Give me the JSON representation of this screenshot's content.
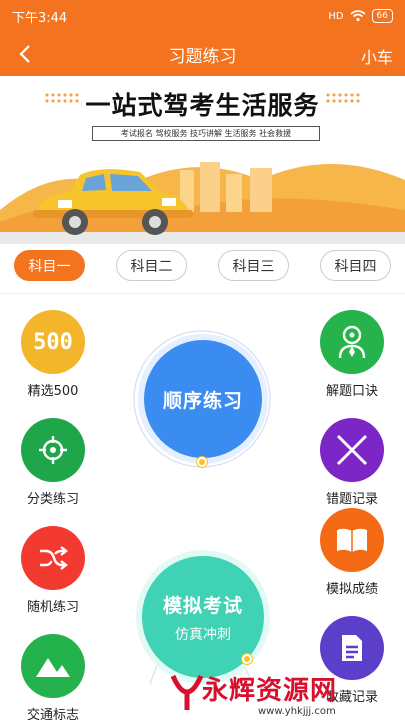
{
  "status_bar": {
    "time": "下午3:44",
    "signal": "HD",
    "battery": "66"
  },
  "header": {
    "title": "习题练习",
    "right": "小车"
  },
  "banner": {
    "headline": "一站式驾考生活服务",
    "tags": "考试报名  驾校服务  技巧讲解  生活服务  社会救援"
  },
  "tabs": [
    {
      "label": "科目一",
      "active": true
    },
    {
      "label": "科目二",
      "active": false
    },
    {
      "label": "科目三",
      "active": false
    },
    {
      "label": "科目四",
      "active": false
    }
  ],
  "left_items": [
    {
      "label": "精选500",
      "icon_text": "500",
      "icon": "500-icon",
      "color": "#f3b62a"
    },
    {
      "label": "分类练习",
      "icon": "target-icon",
      "color": "#1fa64a"
    },
    {
      "label": "随机练习",
      "icon": "shuffle-icon",
      "color": "#f23a30"
    },
    {
      "label": "交通标志",
      "icon": "mountain-icon",
      "color": "#23b24b"
    }
  ],
  "right_items": [
    {
      "label": "解题口诀",
      "icon": "person-icon",
      "color": "#26b34b"
    },
    {
      "label": "错题记录",
      "icon": "cross-icon",
      "color": "#7d26c7"
    },
    {
      "label": "模拟成绩",
      "icon": "book-icon",
      "color": "#f56a14"
    },
    {
      "label": "收藏记录",
      "icon": "document-icon",
      "color": "#5b3ec9"
    }
  ],
  "center": {
    "sequence": "顺序练习",
    "exam_title": "模拟考试",
    "exam_sub": "仿真冲刺"
  },
  "watermark": {
    "text": "永辉资源网",
    "url": "www.yhkjjj.com"
  },
  "colors": {
    "brand": "#f4731f",
    "sequence": "#3b8cf0",
    "exam": "#3fd2b4"
  }
}
